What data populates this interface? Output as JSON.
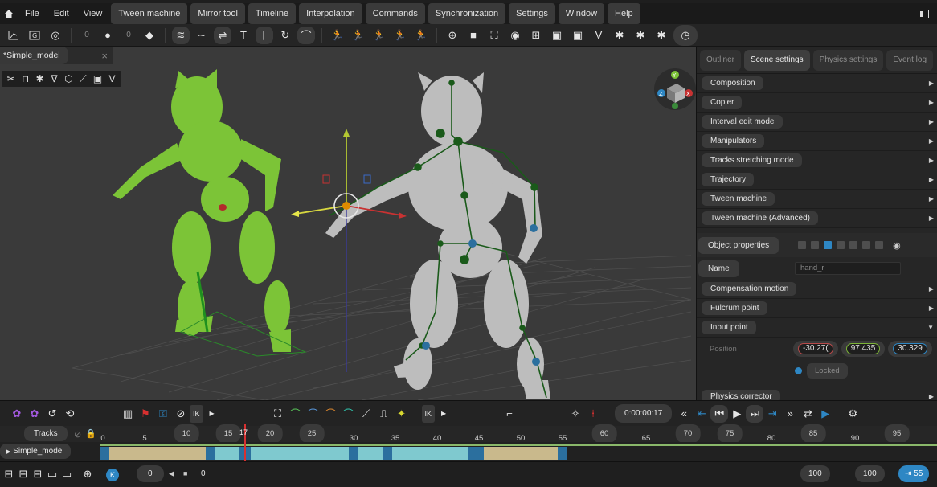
{
  "menubar": {
    "items": [
      "File",
      "Edit",
      "View",
      "Tween machine",
      "Mirror tool",
      "Timeline",
      "Interpolation",
      "Commands",
      "Synchronization",
      "Settings",
      "Window",
      "Help"
    ]
  },
  "toolbar": {
    "value_a": "0",
    "value_b": "0"
  },
  "viewport": {
    "tab_label": "*Simple_model",
    "gizmo_x": "X",
    "gizmo_y": "Y",
    "gizmo_z": "Z"
  },
  "panel": {
    "tabs": [
      "Outliner",
      "Scene settings",
      "Physics settings",
      "Event log"
    ],
    "active_tab": "Scene settings",
    "items": [
      "Composition",
      "Copier",
      "Interval edit mode",
      "Manipulators",
      "Tracks stretching mode",
      "Trajectory",
      "Tween machine",
      "Tween machine (Advanced)"
    ],
    "object_properties": "Object properties",
    "name_label": "Name",
    "name_value": "hand_r",
    "props": [
      "Compensation motion",
      "Fulcrum point",
      "Input point"
    ],
    "position_label": "Position",
    "position_x": "-30.27(",
    "position_y": "97.435",
    "position_z": "30.329",
    "locked_label": "Locked",
    "physics_corrector": "Physics corrector"
  },
  "timeline": {
    "time": "0:00:00:17",
    "tracks_label": "Tracks",
    "model_track": "Simple_model",
    "current_frame": "17",
    "ticks": [
      "0",
      "5",
      "10",
      "15",
      "20",
      "25",
      "30",
      "35",
      "40",
      "45",
      "50",
      "55",
      "60",
      "65",
      "70",
      "75",
      "80",
      "85",
      "90",
      "95",
      "10"
    ],
    "frame_field": "0",
    "frame_field2": "0",
    "end_a": "100",
    "end_b": "100",
    "end_c": "55",
    "ik_label": "IK"
  },
  "colors": {
    "accent_blue": "#2e87c4",
    "green_model": "#7cc437",
    "grey_model": "#bdbdbd",
    "keyframe_blue": "#2b6f9e",
    "key_cyan": "#7fc9cf",
    "key_tan": "#c9b98c"
  }
}
